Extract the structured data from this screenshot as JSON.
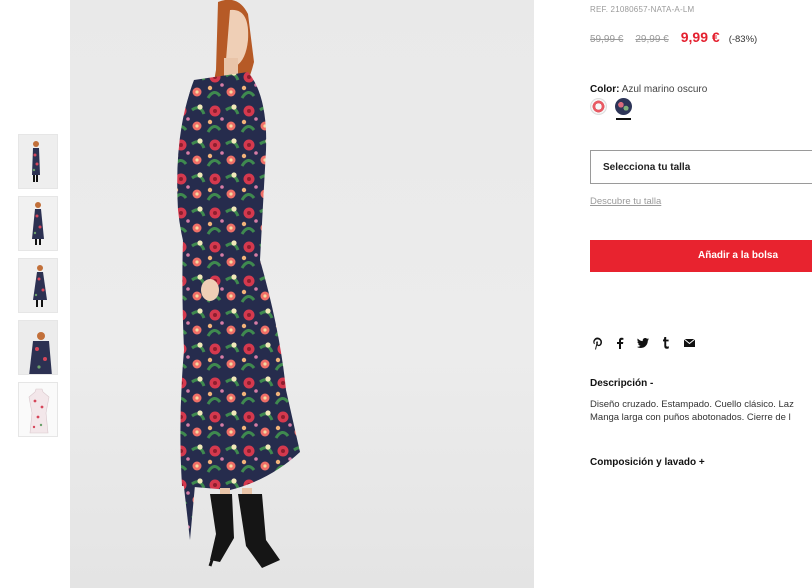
{
  "product": {
    "ref": "REF. 21080657-NATA-A-LM",
    "old_price_1": "59,99 €",
    "old_price_2": "29,99 €",
    "price": "9,99 €",
    "discount": "(-83%)",
    "color_label": "Color:",
    "color_value": "Azul marino oscuro",
    "swatches": [
      "color-swatch-pink",
      "color-swatch-navy"
    ],
    "size_placeholder": "Selecciona tu talla",
    "size_guide": "Descubre tu talla",
    "add_to_bag": "Añadir a la bolsa"
  },
  "social": {
    "icons": [
      "pinterest-icon",
      "facebook-icon",
      "twitter-icon",
      "tumblr-icon",
      "email-icon"
    ]
  },
  "description": {
    "title": "Descripción -",
    "line1": "Diseño cruzado. Estampado. Cuello clásico. Laz",
    "line2": "Manga larga con puños abotonados. Cierre de l"
  },
  "composition": {
    "title": "Composición y lavado +"
  },
  "gallery": {
    "thumbnail_count": 5,
    "selected_thumbnail": 1
  },
  "colors": {
    "sale_red": "#e4202f",
    "button_red": "#e8232f",
    "muted_gray": "#9a9a9a"
  }
}
